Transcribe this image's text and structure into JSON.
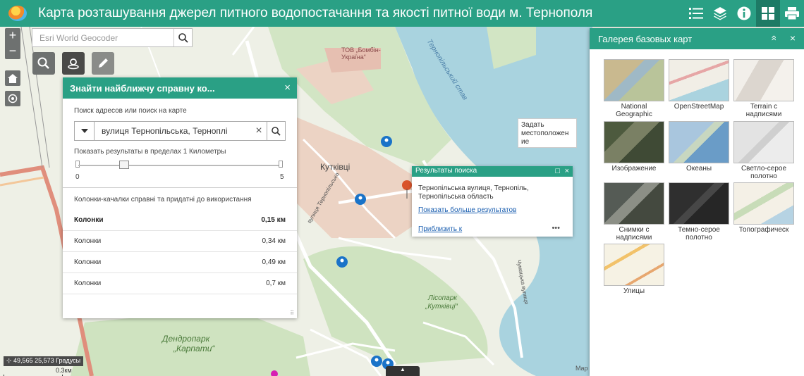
{
  "header": {
    "title": "Карта розташування джерел питного водопостачання та якості питної води м. Тернополя",
    "icons": [
      "list-icon",
      "layers-icon",
      "info-icon",
      "gallery-icon",
      "print-icon"
    ]
  },
  "map_controls": {
    "zoom_in": "+",
    "zoom_out": "−"
  },
  "geocoder": {
    "placeholder": "Esri World Geocoder"
  },
  "nearby": {
    "title": "Знайти найближчу справну ко...",
    "close": "×",
    "search_label": "Поиск адресов или поиск на карте",
    "search_value": "вулиця Тернопільська, Терноплі",
    "clear": "×",
    "range_label": "Показать результаты в пределах 1 Километры",
    "slider_min": "0",
    "slider_max": "5",
    "slider_value": 1,
    "results_title": "Колонки-качалки справні та придатні до використання",
    "results": [
      {
        "name": "Колонки",
        "distance": "0,15 км"
      },
      {
        "name": "Колонки",
        "distance": "0,34 км"
      },
      {
        "name": "Колонки",
        "distance": "0,49 км"
      },
      {
        "name": "Колонки",
        "distance": "0,7 км"
      }
    ]
  },
  "popup": {
    "title": "Результаты поиска",
    "address": "Тернопільська вулиця, Тернопіль, Тернопільська область",
    "more_results": "Показать больше результатов",
    "zoom_to": "Приблизить к",
    "more": "•••"
  },
  "tooltip": {
    "text": "Задать местоположен ие"
  },
  "gallery": {
    "title": "Галерея базовых карт",
    "collapse": "»",
    "close": "×",
    "basemaps": [
      {
        "name": "National Geographic"
      },
      {
        "name": "OpenStreetMap"
      },
      {
        "name": "Terrain с надписями"
      },
      {
        "name": "Изображение"
      },
      {
        "name": "Океаны"
      },
      {
        "name": "Светло-серое полотно"
      },
      {
        "name": "Снимки с надписями"
      },
      {
        "name": "Темно-серое полотно"
      },
      {
        "name": "Топографическ"
      },
      {
        "name": "Улицы"
      }
    ]
  },
  "map_labels": {
    "district": "Кутківці",
    "park1": "Дендропарк",
    "park1b": "„Карпати“",
    "park2": "Лісопарк",
    "park2b": "„Кутківці“",
    "company": "ТОВ „Бомбін-Україна“",
    "lake": "Тернопільський став",
    "street1": "вулиця Тернопільська",
    "street2": "Чумацька вулиця"
  },
  "status": {
    "coords": "49,565 25,573 Градусы",
    "scale": "0.3км",
    "attribution": "Map"
  },
  "colors": {
    "accent": "#2aa085",
    "water": "#a9d3df",
    "park": "#cfe3c0",
    "urban": "#e9c5b4"
  }
}
